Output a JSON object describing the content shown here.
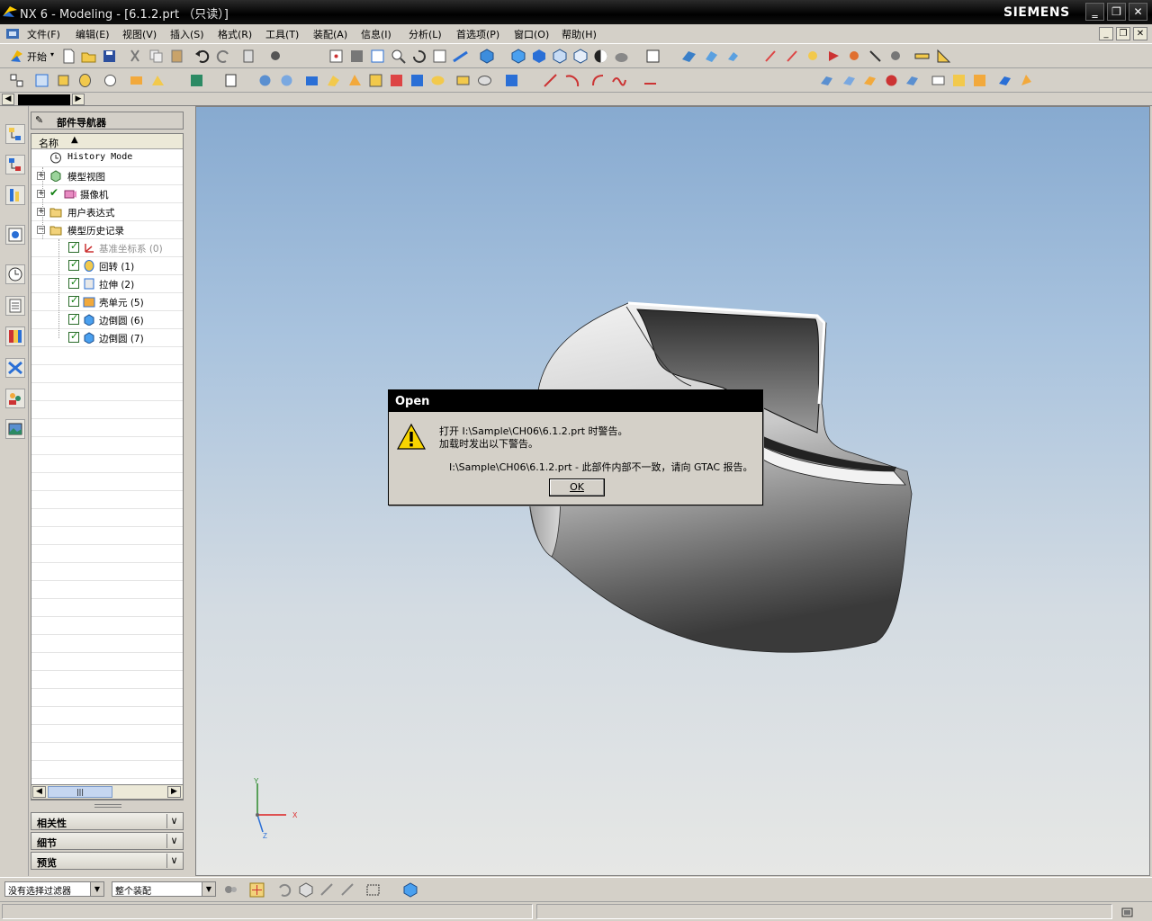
{
  "window": {
    "title": "NX 6 - Modeling - [6.1.2.prt （只读）]",
    "brand": "SIEMENS",
    "controls": {
      "minimize": "‗",
      "restore": "❐",
      "close": "✕"
    }
  },
  "menubar": {
    "items": [
      {
        "label": "文件(F)"
      },
      {
        "label": "编辑(E)"
      },
      {
        "label": "视图(V)"
      },
      {
        "label": "插入(S)"
      },
      {
        "label": "格式(R)"
      },
      {
        "label": "工具(T)"
      },
      {
        "label": "装配(A)"
      },
      {
        "label": "信息(I)"
      },
      {
        "label": "分析(L)"
      },
      {
        "label": "首选项(P)"
      },
      {
        "label": "窗口(O)"
      },
      {
        "label": "帮助(H)"
      }
    ]
  },
  "toolbar": {
    "start_label": "开始"
  },
  "navigator": {
    "title": "部件导航器",
    "column_name": "名称",
    "rows": [
      {
        "label": "History Mode",
        "icon": "clock-icon"
      },
      {
        "label": "模型视图",
        "icon": "view-cube-icon"
      },
      {
        "label": "摄像机",
        "icon": "camera-icon"
      },
      {
        "label": "用户表达式",
        "icon": "folder-icon"
      },
      {
        "label": "模型历史记录",
        "icon": "folder-icon"
      },
      {
        "label": "基准坐标系 (0)",
        "icon": "datum-csys-icon"
      },
      {
        "label": "回转 (1)",
        "icon": "revolve-icon"
      },
      {
        "label": "拉伸 (2)",
        "icon": "extrude-icon"
      },
      {
        "label": "壳单元 (5)",
        "icon": "shell-icon"
      },
      {
        "label": "边倒圆 (6)",
        "icon": "edge-blend-icon"
      },
      {
        "label": "边倒圆 (7)",
        "icon": "edge-blend-icon"
      }
    ]
  },
  "panels": [
    {
      "label": "相关性"
    },
    {
      "label": "细节"
    },
    {
      "label": "预览"
    }
  ],
  "dialog": {
    "title": "Open",
    "line1": "打开 I:\\Sample\\CH06\\6.1.2.prt 时警告。",
    "line2": "加载时发出以下警告。",
    "line3": "I:\\Sample\\CH06\\6.1.2.prt - 此部件内部不一致，请向 GTAC 报告。",
    "ok_label": "OK"
  },
  "bottombar": {
    "filter_value": "没有选择过滤器",
    "scope_value": "整个装配"
  },
  "triad": {
    "x": "X",
    "y": "Y",
    "z": "Z"
  },
  "colors": {
    "title_bg": "#000000",
    "viewport_top": "#87aad0",
    "viewport_bottom": "#e6e7e5",
    "check_green": "#138013"
  }
}
